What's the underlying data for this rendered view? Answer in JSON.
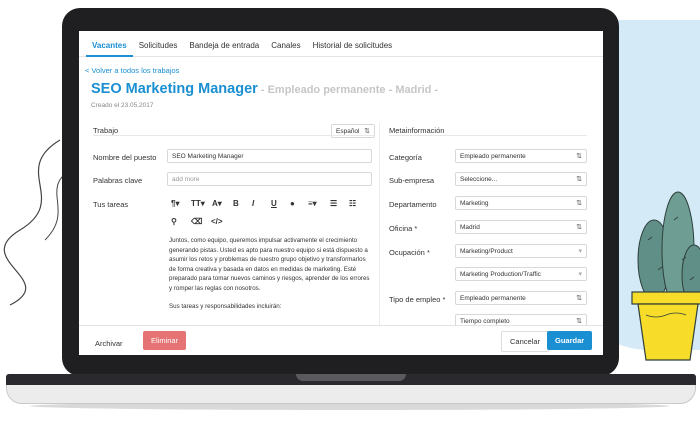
{
  "tabs": [
    {
      "label": "Vacantes",
      "active": true
    },
    {
      "label": "Solicitudes",
      "active": false
    },
    {
      "label": "Bandeja de entrada",
      "active": false
    },
    {
      "label": "Canales",
      "active": false
    },
    {
      "label": "Historial de solicitudes",
      "active": false
    }
  ],
  "header": {
    "back_link": "< Volver a todos los trabajos",
    "title": "SEO Marketing Manager",
    "subtitle": " - Empleado permanente - Madrid -",
    "created": "Creado el 23.05.2017"
  },
  "job": {
    "section_label": "Trabajo",
    "language": "Español",
    "position_label": "Nombre del puesto",
    "position_value": "SEO Marketing Manager",
    "keywords_label": "Palabras clave",
    "keywords_placeholder": "add more",
    "tasks_label": "Tus tareas",
    "editor_paragraph_1": "Juntos, como equipo, queremos impulsar activamente el crecimiento generando pistas. Usted es apto para nuestro equipo si está dispuesto a asumir los retos y problemas de nuestro grupo objetivo y transformarlos de forma creativa y basada en datos en medidas de marketing. Esté preparado para tomar nuevos caminos y riesgos, aprender de los errores y romper las reglas con nosotros.",
    "editor_paragraph_2": "Sus tareas y responsabilidades incluirán:"
  },
  "toolbar": {
    "paragraph": "¶▾",
    "text_size": "TT▾",
    "font_color": "A▾",
    "bold": "B",
    "italic": "I",
    "underline": "U",
    "highlight": "●",
    "align": "≡▾",
    "list_ordered": "☰",
    "list_bullet": "☷",
    "link": "⚲",
    "eraser": "⌫",
    "code": "</>"
  },
  "meta": {
    "section_label": "Metainformación",
    "category_label": "Categoría",
    "category_value": "Empleado permanente",
    "subcompany_label": "Sub-empresa",
    "subcompany_value": "Seleccione...",
    "department_label": "Departamento",
    "department_value": "Marketing",
    "office_label": "Oficina *",
    "office_value": "Madrid",
    "occupation_label": "Ocupación *",
    "occupation_value_1": "Marketing/Product",
    "occupation_value_2": "Marketing Production/Traffic",
    "employment_label": "Tipo de empleo *",
    "employment_value_1": "Empleado permanente",
    "employment_value_2": "Tiempo completo"
  },
  "footer": {
    "archive": "Archivar",
    "delete": "Eliminar",
    "cancel": "Cancelar",
    "save": "Guardar"
  },
  "colors": {
    "accent": "#1a8fd1",
    "danger": "#e57373",
    "laptop_frame": "#1f1f22",
    "backdrop": "#d4eaf6",
    "pot": "#f7dc2a",
    "cactus": "#5f8f86"
  }
}
